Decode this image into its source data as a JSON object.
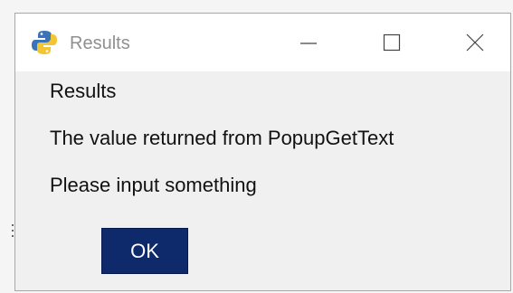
{
  "window": {
    "title": "Results",
    "app_icon": "python-icon",
    "controls": [
      "minimize-icon",
      "maximize-icon",
      "close-icon"
    ]
  },
  "content": {
    "heading": "Results",
    "message": "The value returned from PopupGetText",
    "value": "Please input something"
  },
  "buttons": {
    "ok_label": "OK"
  },
  "colors": {
    "titlebar_bg": "#ffffff",
    "body_bg": "#f0f0f0",
    "button_bg": "#0f2a6b",
    "button_text": "#ffffff",
    "title_text": "#8f8f8f"
  }
}
